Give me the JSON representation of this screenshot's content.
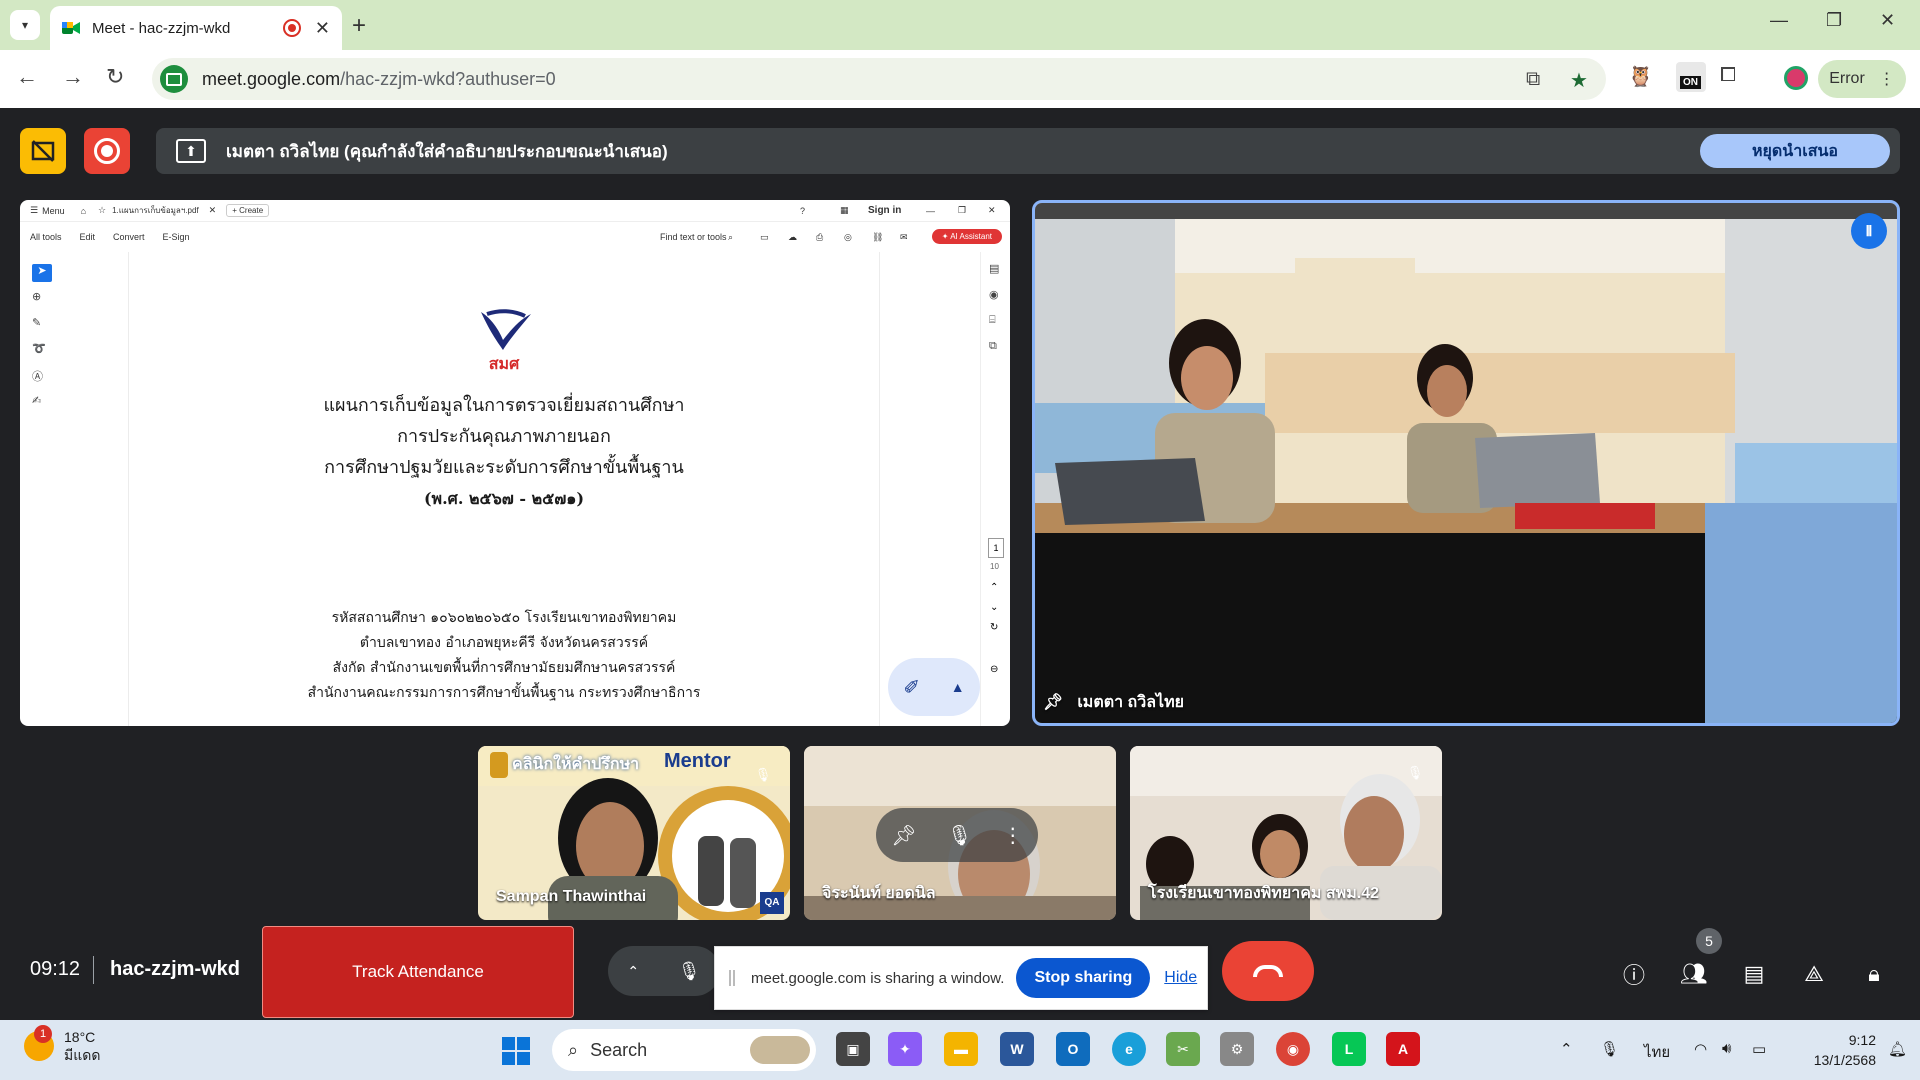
{
  "browser": {
    "tab_title": "Meet - hac-zzjm-wkd",
    "url_main": "meet.google.com",
    "url_rest": "/hac-zzjm-wkd?authuser=0",
    "profile_label": "Error",
    "ext_badge": "ON"
  },
  "meet_top": {
    "presenting_message": "เมตตา ถวิลไทย (คุณกำลังใส่คำอธิบายประกอบขณะนำเสนอ)",
    "stop_presenting_label": "หยุดนำเสนอ"
  },
  "pdf_viewer": {
    "menu_label": "Menu",
    "file_tab": "1.แผนการเก็บข้อมูลฯ.pdf",
    "create_label": "Create",
    "sign_in_label": "Sign in",
    "tools": [
      "All tools",
      "Edit",
      "Convert",
      "E-Sign"
    ],
    "find_label": "Find text or tools",
    "ai_label": "AI Assistant",
    "page_num": "1",
    "page_total": "10",
    "logo_text": "สมศ",
    "doc_title_lines": [
      "แผนการเก็บข้อมูลในการตรวจเยี่ยมสถานศึกษา",
      "การประกันคุณภาพภายนอก",
      "การศึกษาปฐมวัยและระดับการศึกษาขั้นพื้นฐาน",
      "(พ.ศ. ๒๕๖๗ - ๒๕๗๑)"
    ],
    "doc_info_lines": [
      "รหัสสถานศึกษา ๑๐๖๐๒๒๐๖๕๐ โรงเรียนเขาทองพิทยาคม",
      "ตำบลเขาทอง อำเภอพยุหะคีรี จังหวัดนครสวรรค์",
      "สังกัด สำนักงานเขตพื้นที่การศึกษามัธยมศึกษานครสวรรค์",
      "สำนักงานคณะกรรมการการศึกษาขั้นพื้นฐาน กระทรวงศึกษาธิการ"
    ]
  },
  "participants": {
    "main": {
      "name": "เมตตา ถวิลไทย"
    },
    "tiles": [
      {
        "name": "Sampan Thawinthai",
        "banner": "คลินิกให้คำปรึกษา",
        "banner_right": "Mentor"
      },
      {
        "name": "จิระนันท์ ยอดนิล"
      },
      {
        "name": "โรงเรียนเขาทองพิทยาคม สพม.42"
      }
    ]
  },
  "bottom_bar": {
    "time": "09:12",
    "meeting_code": "hac-zzjm-wkd",
    "track_attendance_label": "Track Attendance",
    "share_message": "meet.google.com is sharing a window.",
    "stop_sharing_label": "Stop sharing",
    "hide_label": "Hide",
    "people_count": "5"
  },
  "taskbar": {
    "temperature": "18°C",
    "weather_desc": "มีแดด",
    "weather_badge": "1",
    "search_label": "Search",
    "lang": "ไทย",
    "clock_time": "9:12",
    "clock_date": "13/1/2568"
  },
  "colors": {
    "meet_bg": "#202124",
    "accent_blue": "#8ab4f8",
    "end_call_red": "#ea4335",
    "track_red": "#c5221f"
  }
}
